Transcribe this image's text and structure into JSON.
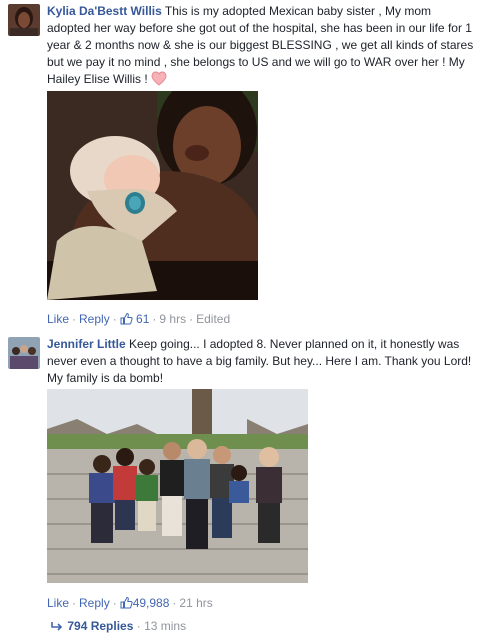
{
  "comments": [
    {
      "author": "Kylia Da'Bestt Willis",
      "text": "This is my adopted Mexican baby sister , My mom adopted her way before she got out of the hospital, she has been in our life for 1 year & 2 months now & she is our biggest BLESSING , we get all kinds of stares but we pay it no mind , she belongs to US and we will go to WAR over her ! My Hailey Elise Willis !",
      "emoji_icon": "heart-icon",
      "like_label": "Like",
      "reply_label": "Reply",
      "reaction_count": "61",
      "timestamp": "9 hrs",
      "edited_label": "Edited"
    },
    {
      "author": "Jennifer Little",
      "text": "Keep going... I adopted 8. Never planned on it, it honestly was never even a thought to have a big family. But hey... Here I am. Thank you Lord! My family is da bomb!",
      "like_label": "Like",
      "reply_label": "Reply",
      "reaction_count": "49,988",
      "timestamp": "21 hrs",
      "replies": {
        "label": "794 Replies",
        "timestamp": "13 mins"
      }
    }
  ],
  "colors": {
    "link": "#365899",
    "action_link": "#4267b2",
    "meta_gray": "#90949c",
    "text": "#1d2129"
  }
}
